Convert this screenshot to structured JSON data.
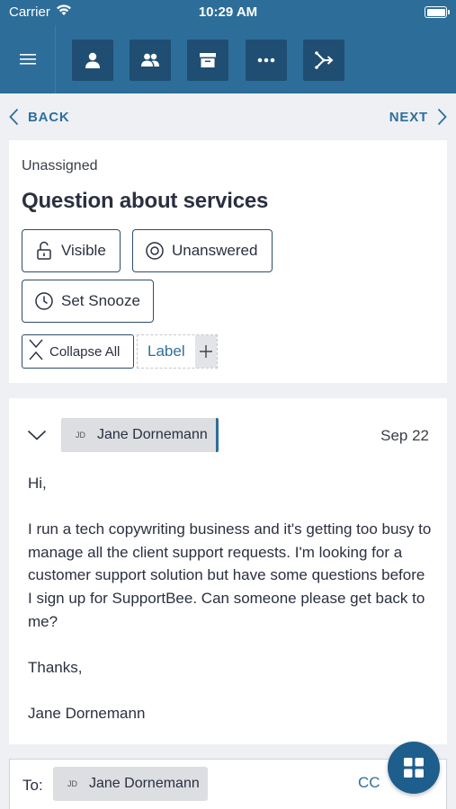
{
  "status_bar": {
    "carrier": "Carrier",
    "time": "10:29 AM"
  },
  "toolbar": {
    "icons": [
      "menu-icon",
      "person-icon",
      "group-icon",
      "archive-icon",
      "more-icon",
      "merge-icon"
    ]
  },
  "nav": {
    "back_label": "BACK",
    "next_label": "NEXT"
  },
  "ticket": {
    "assignee": "Unassigned",
    "title": "Question about services",
    "visibility_label": "Visible",
    "status_label": "Unanswered",
    "snooze_label": "Set Snooze",
    "collapse_label": "Collapse All",
    "label_placeholder": "Label",
    "add_label": "+"
  },
  "message": {
    "sender_initials": "JD",
    "sender_name": "Jane Dornemann",
    "date": "Sep 22",
    "greeting": "Hi,",
    "body": "I run a tech copywriting business and it's getting too busy to manage all the client support requests. I'm looking for a customer support solution but have some questions before I sign up for SupportBee. Can someone please get back to me?",
    "closing": "Thanks,",
    "signature": "Jane Dornemann"
  },
  "compose": {
    "to_label": "To:",
    "recipient_initials": "JD",
    "recipient_name": "Jane Dornemann",
    "cc_label": "CC"
  },
  "colors": {
    "header": "#2d6d99",
    "toolbar_button": "#1f4e72",
    "accent": "#2f6f9c",
    "fab": "#1e5e8c"
  }
}
